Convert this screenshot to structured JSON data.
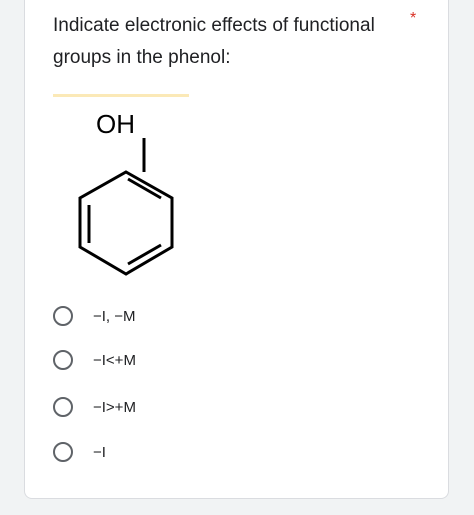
{
  "question": {
    "title": "Indicate electronic effects of functional groups in the phenol:",
    "required_marker": "*",
    "image": {
      "label": "OH"
    },
    "options": [
      {
        "label": "−I, −M"
      },
      {
        "label": "−I<+M"
      },
      {
        "label": "−I>+M"
      },
      {
        "label": "−I"
      }
    ]
  },
  "colors": {
    "required": "#d93025",
    "text": "#202124",
    "radio_border": "#5f6368"
  }
}
